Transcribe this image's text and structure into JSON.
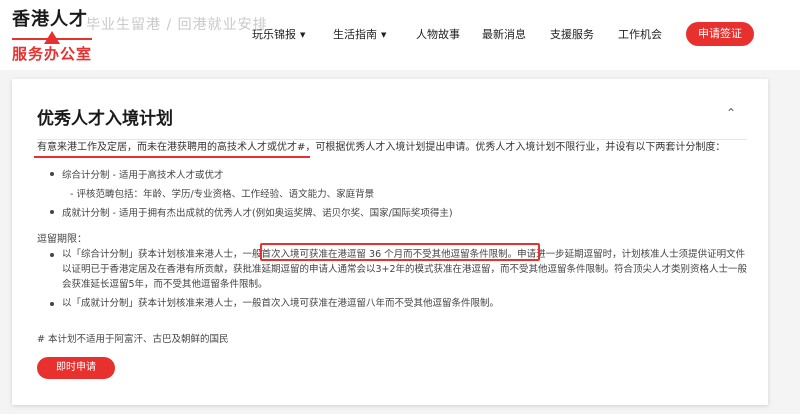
{
  "header": {
    "logo_top": "香港人才",
    "logo_bottom": "服务办公室",
    "ghost_text": "毕业生留港 / 回港就业安排",
    "nav": [
      {
        "label": "玩乐锦报",
        "has_caret": true
      },
      {
        "label": "生活指南",
        "has_caret": true
      },
      {
        "label": "人物故事",
        "has_caret": false
      },
      {
        "label": "最新消息",
        "has_caret": false
      },
      {
        "label": "支援服务",
        "has_caret": false
      },
      {
        "label": "工作机会",
        "has_caret": false
      }
    ],
    "apply_label": "申请签证"
  },
  "card": {
    "title": "优秀人才入境计划",
    "intro_highlight": "有意来港工作及定居，而未在港获聘用的高技术人才或优才#",
    "intro_rest": "，可根据优秀人才入境计划提出申请。优秀人才入境计划不限行业，并设有以下两套计分制度：",
    "scoring": [
      {
        "text": "综合计分制 - 适用于高技术人才或优才",
        "sub": "- 评核范畴包括：年龄、学历/专业资格、工作经验、语文能力、家庭背景"
      },
      {
        "text": "成就计分制 - 适用于拥有杰出成就的优秀人才(例如奥运奖牌、诺贝尔奖、国家/国际奖项得主)",
        "sub": ""
      }
    ],
    "stay_label": "逗留期限：",
    "stay_items": [
      {
        "pre": "以「综合计分制」获本计划核准来港人士，",
        "boxed": "一般首次入境可获准在港逗留 36 个月而不受其他逗留条件限制",
        "post": "。申请进一步延期逗留时，计划核准人士须提供证明文件以证明已于香港定居及在香港有所贡献，获批准延期逗留的申请人通常会以3+2年的模式获准在港逗留，而不受其他逗留条件限制。符合顶尖人才类别资格人士一般会获准延长逗留5年，而不受其他逗留条件限制。"
      },
      {
        "pre": "以「成就计分制」获本计划核准来港人士，一般首次入境可获准在港逗留八年而不受其他逗留条件限制。",
        "boxed": "",
        "post": ""
      }
    ],
    "footnote": "# 本计划不适用于阿富汗、古巴及朝鲜的国民",
    "now_label": "即时申请"
  }
}
